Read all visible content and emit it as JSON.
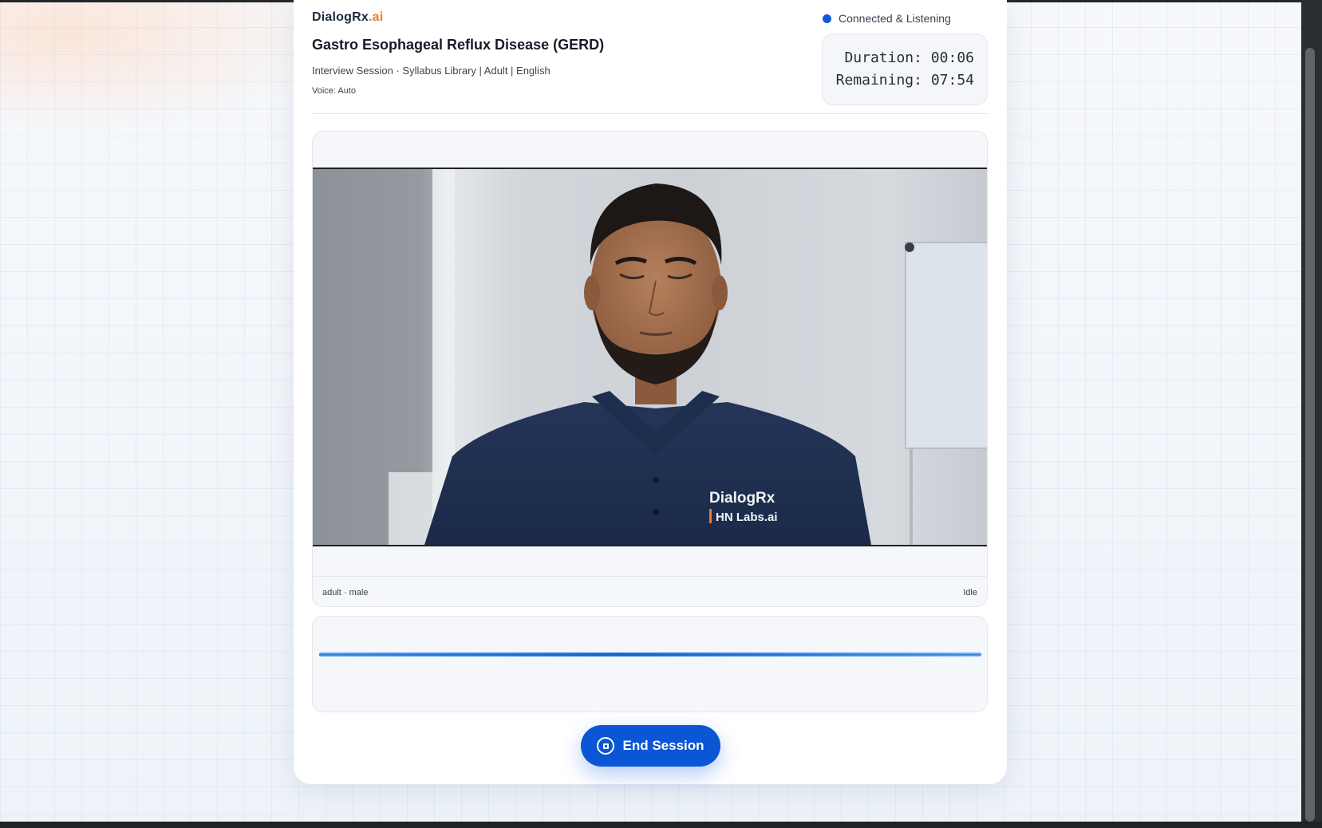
{
  "app": {
    "brand_main": "DialogRx",
    "brand_suffix": ".ai"
  },
  "session": {
    "title": "Gastro Esophageal Reflux Disease (GERD)",
    "subtitle": "Interview Session · Syllabus Library | Adult | English",
    "voice": "Voice: Auto"
  },
  "status": {
    "label": "Connected & Listening",
    "color": "#1159d6"
  },
  "timer": {
    "duration": "Duration: 00:06",
    "remaining": "Remaining: 07:54"
  },
  "video": {
    "patient_label": "adult · male",
    "state": "Idle",
    "shirt_logo_line1": "DialogRx",
    "shirt_logo_line2": "HN Labs.ai"
  },
  "controls": {
    "end_session_label": "End Session"
  },
  "colors": {
    "accent": "#0a56d4",
    "brand_orange": "#f07a28"
  }
}
